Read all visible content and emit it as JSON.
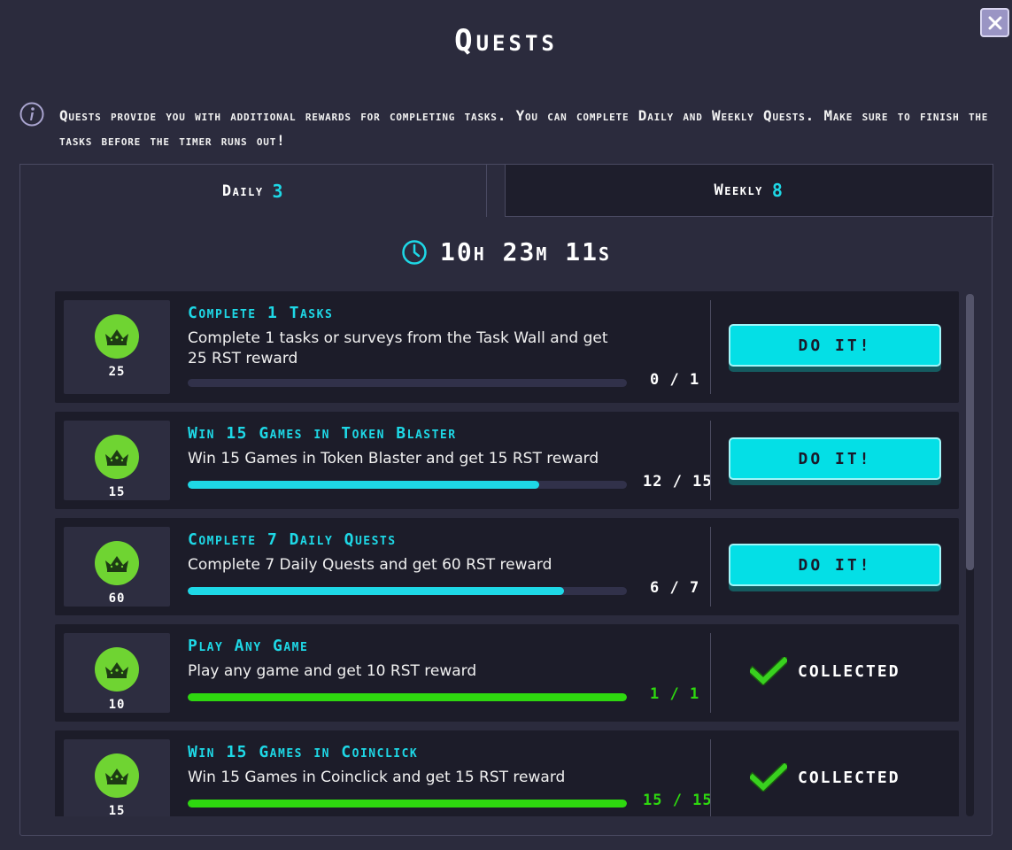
{
  "header": {
    "title": "Quests",
    "close_label": "✕"
  },
  "info": {
    "icon": "info-icon",
    "text": "Quests provide you with additional rewards for completing tasks. You can complete Daily and Weekly Quests. Make sure to finish the tasks before the timer runs out!"
  },
  "tabs": [
    {
      "label": "Daily",
      "count": "3",
      "active": true
    },
    {
      "label": "Weekly",
      "count": "8",
      "active": false
    }
  ],
  "timer": {
    "icon": "clock-icon",
    "value": "10h 23m 11s"
  },
  "quests": [
    {
      "reward": "25",
      "reward_icon": "crown-icon",
      "title": "Complete 1 Tasks",
      "description": "Complete 1 tasks or surveys from the Task Wall and get 25 RST reward",
      "progress_text": "0 / 1",
      "progress": 0.0,
      "action": "DO IT!",
      "status": "open"
    },
    {
      "reward": "15",
      "reward_icon": "crown-icon",
      "title": "Win 15 Games in Token Blaster",
      "description": "Win 15 Games in Token Blaster and get 15 RST reward",
      "progress_text": "12 / 15",
      "progress": 0.8,
      "action": "DO IT!",
      "status": "open"
    },
    {
      "reward": "60",
      "reward_icon": "crown-icon",
      "title": "Complete 7 Daily Quests",
      "description": "Complete 7 Daily Quests and get 60 RST reward",
      "progress_text": "6 / 7",
      "progress": 0.857,
      "action": "DO IT!",
      "status": "open"
    },
    {
      "reward": "10",
      "reward_icon": "crown-icon",
      "title": "Play Any Game",
      "description": "Play any game and get 10 RST reward",
      "progress_text": "1 / 1",
      "progress": 1.0,
      "action": "COLLECTED",
      "status": "collected"
    },
    {
      "reward": "15",
      "reward_icon": "crown-icon",
      "title": "Win 15 Games in Coinclick",
      "description": "Win 15 Games in Coinclick and get 15 RST reward",
      "progress_text": "15 / 15",
      "progress": 1.0,
      "action": "COLLECTED",
      "status": "collected"
    }
  ],
  "colors": {
    "accent": "#1ed8e6",
    "progress_open": "#1ed8e6",
    "progress_done": "#2ed80f",
    "done_text": "#2ed80f",
    "button": "#04dfe6"
  }
}
